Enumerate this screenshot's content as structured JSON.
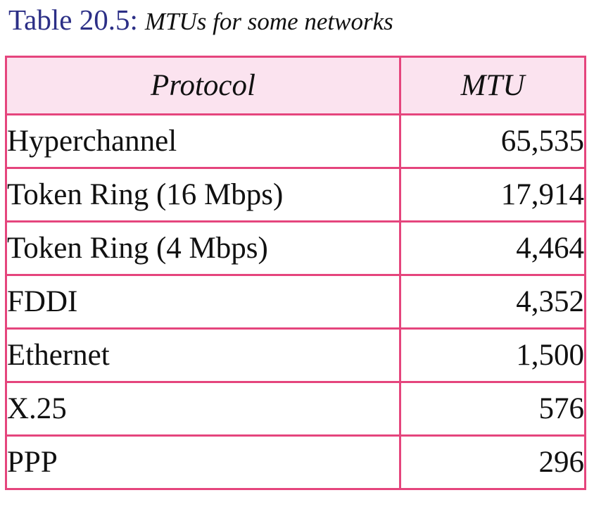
{
  "caption": {
    "label": "Table 20.5:",
    "text": "MTUs for some networks"
  },
  "table": {
    "headers": {
      "protocol": "Protocol",
      "mtu": "MTU"
    },
    "rows": [
      {
        "protocol": "Hyperchannel",
        "mtu": "65,535"
      },
      {
        "protocol": "Token Ring (16 Mbps)",
        "mtu": "17,914"
      },
      {
        "protocol": "Token Ring (4 Mbps)",
        "mtu": "4,464"
      },
      {
        "protocol": "FDDI",
        "mtu": "4,352"
      },
      {
        "protocol": "Ethernet",
        "mtu": "1,500"
      },
      {
        "protocol": "X.25",
        "mtu": "576"
      },
      {
        "protocol": "PPP",
        "mtu": "296"
      }
    ]
  },
  "colors": {
    "border": "#e5457d",
    "header_background": "#fbe3ef",
    "caption_label": "#2c2f86"
  }
}
